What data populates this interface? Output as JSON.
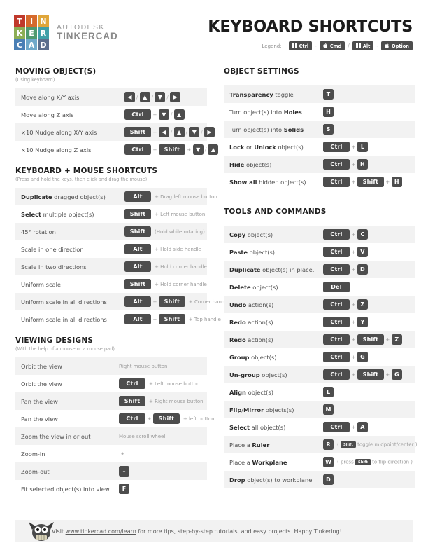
{
  "header": {
    "logo_tiles": [
      {
        "letter": "T",
        "color": "#c0392b"
      },
      {
        "letter": "I",
        "color": "#d66a2c"
      },
      {
        "letter": "N",
        "color": "#e0a63a"
      },
      {
        "letter": "K",
        "color": "#8cae54"
      },
      {
        "letter": "E",
        "color": "#4f9a6e"
      },
      {
        "letter": "R",
        "color": "#3f9fa8"
      },
      {
        "letter": "C",
        "color": "#4a7fb5"
      },
      {
        "letter": "A",
        "color": "#6fa8c9"
      },
      {
        "letter": "D",
        "color": "#5b6e8c"
      }
    ],
    "brand_top": "AUTODESK",
    "brand_bottom": "TINKERCAD",
    "title": "KEYBOARD SHORTCUTS",
    "legend_label": "Legend:",
    "legend_keys": [
      {
        "label": "Ctrl",
        "icon": "windows-icon"
      },
      {
        "label": "Cmd",
        "icon": "apple-icon"
      },
      {
        "label": "Alt",
        "icon": "windows-icon"
      },
      {
        "label": "Option",
        "icon": "apple-icon"
      }
    ],
    "legend_separators": [
      "-",
      "/",
      "-"
    ]
  },
  "sections": {
    "moving": {
      "heading": "MOVING OBJECT(S)",
      "subheading": "(Using keyboard)",
      "rows": [
        {
          "label": "Move along X/Y axis",
          "keys": [
            "◀",
            "/",
            "▲",
            "/",
            "▼",
            "/",
            "▶"
          ]
        },
        {
          "label": "Move along Z axis",
          "keys": [
            "Ctrl",
            "+",
            "▼",
            "/",
            "▲"
          ]
        },
        {
          "label": "×10 Nudge along X/Y axis",
          "keys": [
            "Shift",
            "+",
            "◀",
            "/",
            "▲",
            "/",
            "▼",
            "/",
            "▶"
          ]
        },
        {
          "label": "×10 Nudge along Z axis",
          "keys": [
            "Ctrl",
            "+",
            "Shift",
            "+",
            "▼",
            "/",
            "▲"
          ]
        }
      ]
    },
    "keyboard_mouse": {
      "heading": "KEYBOARD + MOUSE SHORTCUTS",
      "subheading": "(Press and hold the keys, then click and drag the mouse)",
      "rows": [
        {
          "bold": "Duplicate",
          "rest": " dragged object(s)",
          "keys": [
            "Alt"
          ],
          "note": "+ Drag left mouse button"
        },
        {
          "bold": "Select",
          "rest": " multiple object(s)",
          "keys": [
            "Shift"
          ],
          "note": "+ Left mouse button"
        },
        {
          "bold": "",
          "rest": "45° rotation",
          "keys": [
            "Shift"
          ],
          "note": "(Hold while rotating)"
        },
        {
          "bold": "",
          "rest": "Scale in one direction",
          "keys": [
            "Alt"
          ],
          "note": "+ Hold side handle"
        },
        {
          "bold": "",
          "rest": "Scale in two directions",
          "keys": [
            "Alt"
          ],
          "note": "+ Hold corner handle"
        },
        {
          "bold": "",
          "rest": "Uniform scale",
          "keys": [
            "Shift"
          ],
          "note": "+ Hold corner handle"
        },
        {
          "bold": "",
          "rest": "Uniform scale in all directions",
          "keys": [
            "Alt",
            "+",
            "Shift"
          ],
          "note": "+ Corner handle"
        },
        {
          "bold": "",
          "rest": "Uniform scale in all directions",
          "keys": [
            "Alt",
            "+",
            "Shift"
          ],
          "note": "+ Top handle"
        }
      ]
    },
    "viewing": {
      "heading": "VIEWING DESIGNS",
      "subheading": "(With the help of a mouse or a mouse pad)",
      "rows": [
        {
          "label": "Orbit the view",
          "keys": [],
          "note": "Right mouse button",
          "note_plain": true
        },
        {
          "label": "Orbit the view",
          "keys": [
            "Ctrl"
          ],
          "note": "+ Left mouse button"
        },
        {
          "label": "Pan the view",
          "keys": [
            "Shift"
          ],
          "note": "+ Right mouse button"
        },
        {
          "label": "Pan the view",
          "keys": [
            "Ctrl",
            "+",
            "Shift"
          ],
          "note": "+ left button"
        },
        {
          "label": "Zoom the view in or out",
          "keys": [],
          "note": "Mouse scroll wheel",
          "note_plain": true
        },
        {
          "label": "Zoom-in",
          "keys": [
            "+"
          ],
          "note": ""
        },
        {
          "label": "Zoom-out",
          "keys": [
            "–"
          ],
          "note": ""
        },
        {
          "label": "Fit selected object(s) into view",
          "keys": [
            "F"
          ],
          "note": ""
        }
      ]
    },
    "object_settings": {
      "heading": "OBJECT SETTINGS",
      "rows": [
        {
          "bold": "Transparency",
          "rest": " toggle",
          "keys": [
            "T"
          ]
        },
        {
          "pre": "Turn object(s) into ",
          "bold": "Holes",
          "rest": "",
          "keys": [
            "H"
          ]
        },
        {
          "pre": "Turn object(s) into ",
          "bold": "Solids",
          "rest": "",
          "keys": [
            "S"
          ]
        },
        {
          "bold": "Lock",
          "mid": " or ",
          "bold2": "Unlock",
          "rest": " object(s)",
          "keys": [
            "Ctrl",
            "+",
            "L"
          ]
        },
        {
          "bold": "Hide",
          "rest": " object(s)",
          "keys": [
            "Ctrl",
            "+",
            "H"
          ]
        },
        {
          "bold": "Show all",
          "rest": " hidden object(s)",
          "keys": [
            "Ctrl",
            "+",
            "Shift",
            "+",
            "H"
          ]
        }
      ]
    },
    "tools": {
      "heading": "TOOLS AND COMMANDS",
      "rows": [
        {
          "bold": "Copy",
          "rest": " object(s)",
          "keys": [
            "Ctrl",
            "+",
            "C"
          ]
        },
        {
          "bold": "Paste",
          "rest": " object(s)",
          "keys": [
            "Ctrl",
            "+",
            "V"
          ]
        },
        {
          "bold": "Duplicate",
          "rest": " object(s) in place.",
          "keys": [
            "Ctrl",
            "+",
            "D"
          ]
        },
        {
          "bold": "Delete",
          "rest": " object(s)",
          "keys": [
            "Del"
          ]
        },
        {
          "bold": "Undo",
          "rest": " action(s)",
          "keys": [
            "Ctrl",
            "+",
            "Z"
          ]
        },
        {
          "bold": "Redo",
          "rest": " action(s)",
          "keys": [
            "Ctrl",
            "+",
            "Y"
          ]
        },
        {
          "bold": "Redo",
          "rest": " action(s)",
          "keys": [
            "Ctrl",
            "+",
            "Shift",
            "+",
            "Z"
          ]
        },
        {
          "bold": "Group",
          "rest": " object(s)",
          "keys": [
            "Ctrl",
            "+",
            "G"
          ]
        },
        {
          "bold": "Un-group",
          "rest": " object(s)",
          "keys": [
            "Ctrl",
            "+",
            "Shift",
            "+",
            "G"
          ]
        },
        {
          "bold": "Align",
          "rest": " object(s)",
          "keys": [
            "L"
          ]
        },
        {
          "bold": "Flip",
          "mid": "/",
          "bold2": "Mirror",
          "rest": " objects(s)",
          "keys": [
            "M"
          ]
        },
        {
          "bold": "Select",
          "rest": " all object(s)",
          "keys": [
            "Ctrl",
            "+",
            "A"
          ]
        },
        {
          "pre": "Place a ",
          "bold": "Ruler",
          "rest": "",
          "keys": [
            "R"
          ],
          "inline": {
            "open": "(",
            "tiny": "Shift",
            "text": "toggle midpoint/center",
            "close": ")"
          }
        },
        {
          "pre": "Place a ",
          "bold": "Workplane",
          "rest": "",
          "keys": [
            "W"
          ],
          "inline": {
            "open": "( press",
            "tiny": "Shift",
            "text": "to flip direction",
            "close": ")"
          }
        },
        {
          "bold": "Drop",
          "rest": " object(s) to workplane",
          "keys": [
            "D"
          ]
        }
      ]
    }
  },
  "footer": {
    "prefix": "Visit ",
    "link": "www.tinkercad.com/learn",
    "suffix": " for more tips, step-by-step tutorials, and easy projects. Happy Tinkering!"
  }
}
